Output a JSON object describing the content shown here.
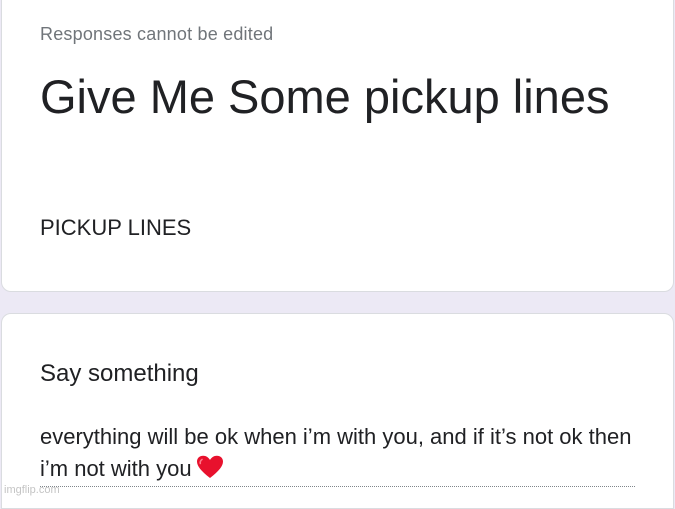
{
  "header": {
    "notice": "Responses cannot be edited",
    "title": "Give Me Some pickup lines",
    "description": "PICKUP LINES"
  },
  "question": {
    "label": "Say something",
    "answer": "everything will be ok when i’m with you, and if it’s not ok then i’m not with you",
    "answer_icon": "red-heart-emoji"
  },
  "watermark": "imgflip.com",
  "colors": {
    "page_background": "#ece9f5",
    "card_background": "#ffffff",
    "heart": "#e8112d"
  }
}
